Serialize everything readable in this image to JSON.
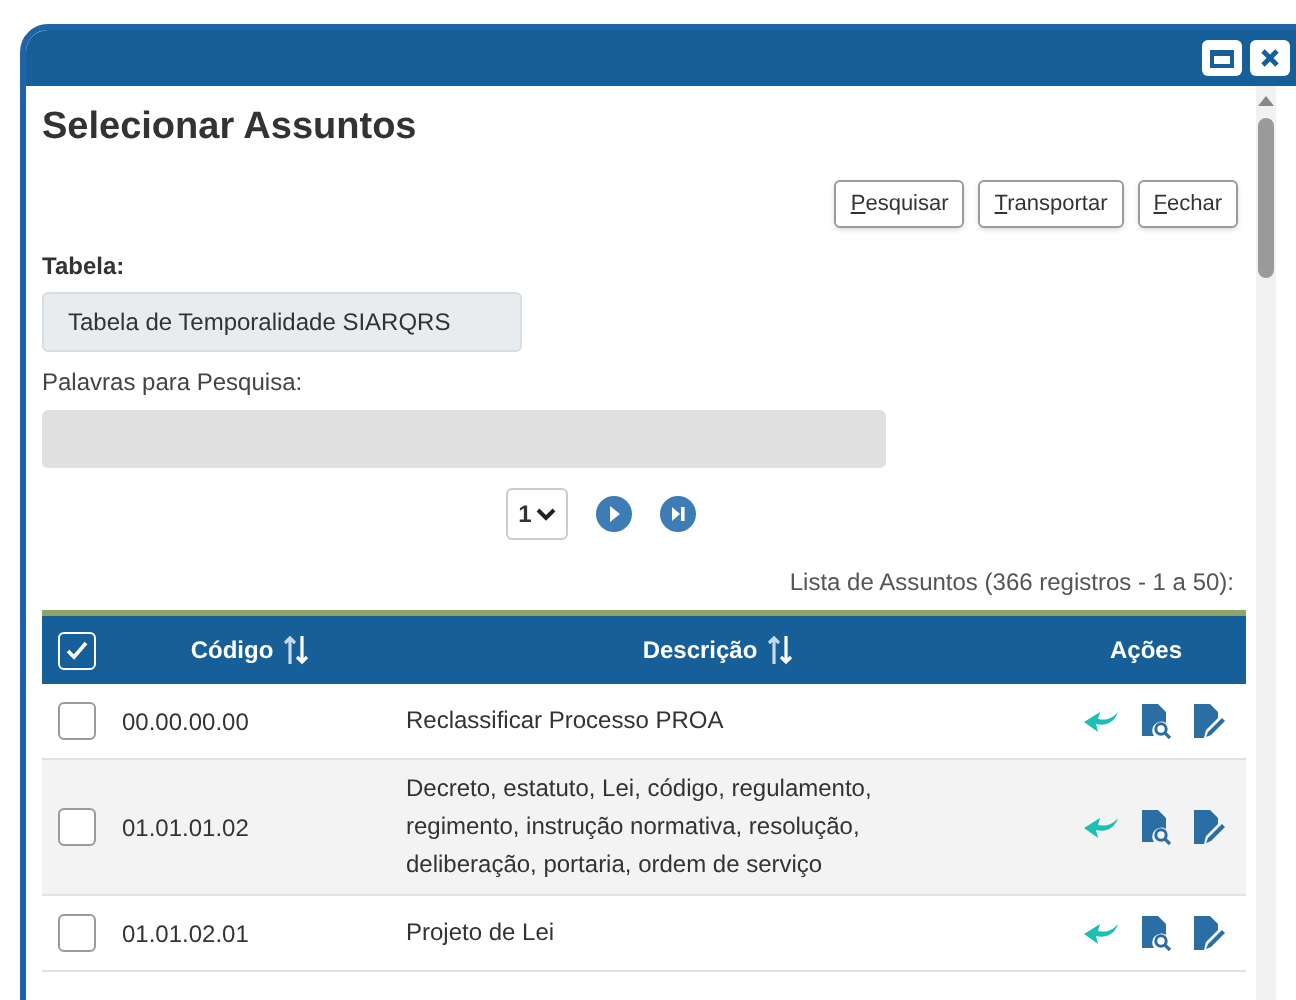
{
  "window": {
    "title": "Selecionar Assuntos"
  },
  "buttons": [
    {
      "label": "Pesquisar"
    },
    {
      "label": "Transportar"
    },
    {
      "label": "Fechar"
    }
  ],
  "table_field": {
    "label": "Tabela:",
    "value": "Tabela de Temporalidade SIARQRS"
  },
  "search": {
    "label": "Palavras para Pesquisa:"
  },
  "pagination": {
    "page": "1"
  },
  "list_summary": "Lista de Assuntos (366 registros - 1 a 50):",
  "table": {
    "select_all": {
      "checked": true
    },
    "columns": [
      "Código",
      "Descrição",
      "Ações"
    ],
    "rows": [
      {
        "checked": false,
        "code": "00.00.00.00",
        "description": "Reclassificar Processo PROA"
      },
      {
        "checked": false,
        "code": "01.01.01.02",
        "description": "Decreto, estatuto, Lei, código, regulamento, regimento, instrução normativa, resolução, deliberação, portaria, ordem de serviço"
      },
      {
        "checked": false,
        "code": "01.01.02.01",
        "description": "Projeto de Lei"
      }
    ]
  }
}
